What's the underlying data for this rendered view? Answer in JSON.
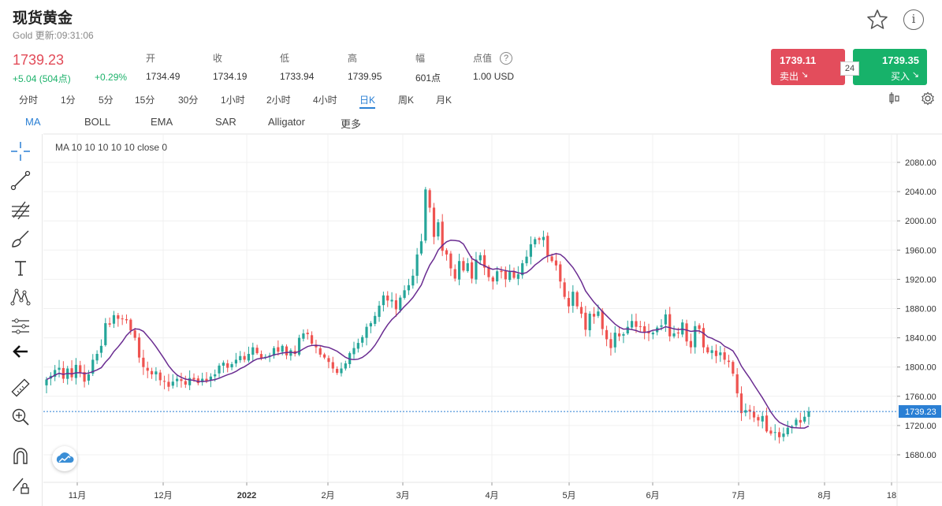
{
  "header": {
    "title": "现货黄金",
    "subtitle": "Gold 更新:09:31:06",
    "price": "1739.23",
    "change": "+5.04 (504点)",
    "change_pct": "+0.29%"
  },
  "stats": [
    {
      "label": "开",
      "value": "1734.49"
    },
    {
      "label": "收",
      "value": "1734.19"
    },
    {
      "label": "低",
      "value": "1733.94"
    },
    {
      "label": "高",
      "value": "1739.95"
    },
    {
      "label": "幅",
      "value": "601点"
    },
    {
      "label": "点值",
      "value": "1.00 USD"
    }
  ],
  "trade": {
    "sell_price": "1739.11",
    "sell_label": "卖出",
    "buy_price": "1739.35",
    "buy_label": "买入",
    "spread": "24"
  },
  "timeframes": [
    "分时",
    "1分",
    "5分",
    "15分",
    "30分",
    "1小时",
    "2小时",
    "4小时",
    "日K",
    "周K",
    "月K"
  ],
  "active_timeframe": "日K",
  "indicators": [
    "MA",
    "BOLL",
    "EMA",
    "SAR",
    "Alligator",
    "更多"
  ],
  "active_indicator": "MA",
  "ma_legend": "MA  10 10 10 10 10 close 0",
  "icons": {
    "star": "star-icon",
    "info": "info-icon",
    "help": "help-icon",
    "tools": [
      "crosshair-icon",
      "trend-line-icon",
      "fib-icon",
      "brush-icon",
      "text-icon",
      "pattern-icon",
      "measure-lines-icon",
      "back-arrow-icon",
      "ruler-icon",
      "zoom-in-icon",
      "magnet-icon",
      "lock-edit-icon"
    ]
  },
  "colors": {
    "up": "#26a69a",
    "down": "#ef5350",
    "ma": "#6a2c91",
    "accent": "#2a7fd4",
    "last_price": "#2a7fd4"
  },
  "chart_data": {
    "type": "candlestick",
    "y_ticks": [
      "2080.00",
      "2040.00",
      "2000.00",
      "1960.00",
      "1920.00",
      "1880.00",
      "1840.00",
      "1800.00",
      "1760.00",
      "1720.00",
      "1680.00"
    ],
    "ylim": [
      1660,
      2100
    ],
    "x_ticks": [
      "11月",
      "12月",
      "2022",
      "2月",
      "3月",
      "4月",
      "5月",
      "6月",
      "7月",
      "8月",
      "18"
    ],
    "last_price_label": "1739.23",
    "last_price": 1739.23,
    "ma_period": 10,
    "closes": [
      1783,
      1788,
      1796,
      1799,
      1784,
      1798,
      1786,
      1803,
      1793,
      1780,
      1790,
      1810,
      1818,
      1829,
      1860,
      1858,
      1871,
      1866,
      1866,
      1864,
      1850,
      1840,
      1813,
      1800,
      1795,
      1790,
      1794,
      1782,
      1780,
      1773,
      1780,
      1784,
      1781,
      1776,
      1785,
      1783,
      1778,
      1784,
      1781,
      1787,
      1790,
      1802,
      1806,
      1799,
      1804,
      1810,
      1815,
      1810,
      1818,
      1827,
      1819,
      1812,
      1814,
      1816,
      1826,
      1821,
      1829,
      1816,
      1823,
      1818,
      1840,
      1846,
      1845,
      1832,
      1827,
      1817,
      1813,
      1807,
      1798,
      1792,
      1798,
      1805,
      1819,
      1826,
      1833,
      1841,
      1855,
      1860,
      1870,
      1884,
      1898,
      1891,
      1892,
      1879,
      1895,
      1905,
      1912,
      1925,
      1954,
      1972,
      2043,
      2018,
      1978,
      1998,
      1959,
      1954,
      1935,
      1921,
      1945,
      1932,
      1942,
      1921,
      1947,
      1953,
      1936,
      1923,
      1917,
      1931,
      1930,
      1920,
      1930,
      1922,
      1927,
      1942,
      1951,
      1968,
      1975,
      1974,
      1978,
      1952,
      1945,
      1939,
      1917,
      1896,
      1883,
      1903,
      1883,
      1873,
      1851,
      1873,
      1869,
      1876,
      1852,
      1838,
      1826,
      1847,
      1842,
      1845,
      1855,
      1863,
      1855,
      1855,
      1848,
      1846,
      1847,
      1854,
      1857,
      1872,
      1842,
      1846,
      1846,
      1861,
      1835,
      1827,
      1856,
      1852,
      1827,
      1820,
      1823,
      1815,
      1820,
      1810,
      1807,
      1791,
      1764,
      1737,
      1741,
      1739,
      1731,
      1727,
      1733,
      1712,
      1709,
      1711,
      1704,
      1709,
      1717,
      1719,
      1728,
      1724,
      1732,
      1739.23
    ]
  }
}
